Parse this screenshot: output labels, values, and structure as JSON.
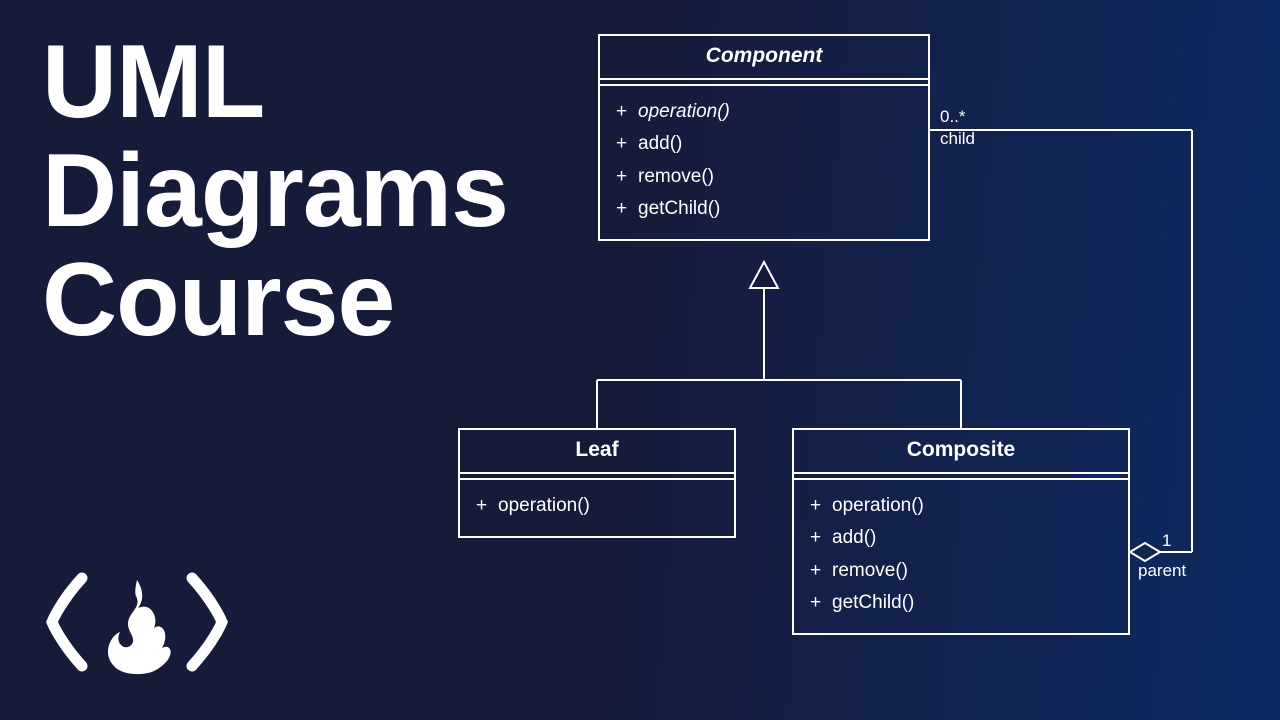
{
  "title": {
    "line1": "UML",
    "line2": "Diagrams",
    "line3": "Course"
  },
  "classes": {
    "component": {
      "name": "Component",
      "name_italic": true,
      "ops": [
        {
          "sign": "+",
          "name": "operation()",
          "italic": true
        },
        {
          "sign": "+",
          "name": "add()",
          "italic": false
        },
        {
          "sign": "+",
          "name": "remove()",
          "italic": false
        },
        {
          "sign": "+",
          "name": "getChild()",
          "italic": false
        }
      ]
    },
    "leaf": {
      "name": "Leaf",
      "name_italic": false,
      "ops": [
        {
          "sign": "+",
          "name": "operation()",
          "italic": false
        }
      ]
    },
    "composite": {
      "name": "Composite",
      "name_italic": false,
      "ops": [
        {
          "sign": "+",
          "name": "operation()",
          "italic": false
        },
        {
          "sign": "+",
          "name": "add()",
          "italic": false
        },
        {
          "sign": "+",
          "name": "remove()",
          "italic": false
        },
        {
          "sign": "+",
          "name": "getChild()",
          "italic": false
        }
      ]
    }
  },
  "relations": {
    "generalization": {
      "parent": "Component",
      "children": [
        "Leaf",
        "Composite"
      ]
    },
    "aggregation": {
      "whole": "Composite",
      "part": "Component",
      "whole_multiplicity": "1",
      "whole_role": "parent",
      "part_multiplicity": "0..*",
      "part_role": "child"
    }
  }
}
